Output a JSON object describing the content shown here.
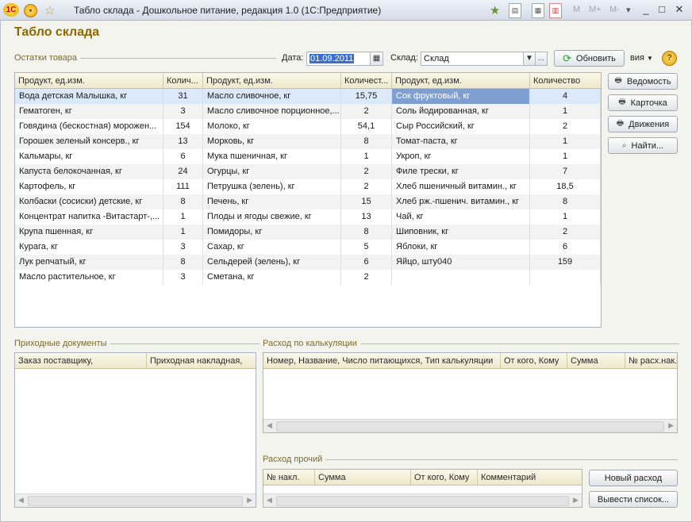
{
  "window": {
    "title": "Табло склада - Дошкольное питание, редакция 1.0  (1С:Предприятие)",
    "logo": "1С",
    "mem_buttons": [
      "M",
      "M+",
      "M-"
    ]
  },
  "form": {
    "title": "Табло склада",
    "stock_group": "Остатки товара",
    "date_label": "Дата:",
    "date_value": "01.09.2011",
    "warehouse_label": "Склад:",
    "warehouse_value": "Склад",
    "ellipsis": "...",
    "refresh_label": "Обновить",
    "actions_label": "вия",
    "help": "?"
  },
  "main_table": {
    "headers": [
      "Продукт, ед.изм.",
      "Колич...",
      "Продукт, ед.изм.",
      "Количест...",
      "Продукт, ед.изм.",
      "Количество"
    ],
    "rows": [
      [
        "Вода детская Малышка, кг",
        "31",
        "Масло сливочное, кг",
        "15,75",
        "Сок фруктовый, кг",
        "4"
      ],
      [
        "Гематоген, кг",
        "3",
        "Масло сливочное порционное,...",
        "2",
        "Соль йодированная, кг",
        "1"
      ],
      [
        "Говядина (бескостная) морожен...",
        "154",
        "Молоко, кг",
        "54,1",
        "Сыр Российский, кг",
        "2"
      ],
      [
        "Горошек зеленый консерв., кг",
        "13",
        "Морковь, кг",
        "8",
        "Томат-паста, кг",
        "1"
      ],
      [
        "Кальмары, кг",
        "6",
        "Мука пшеничная, кг",
        "1",
        "Укроп, кг",
        "1"
      ],
      [
        "Капуста белокочанная, кг",
        "24",
        "Огурцы, кг",
        "2",
        "Филе трески, кг",
        "7"
      ],
      [
        "Картофель, кг",
        "111",
        "Петрушка (зелень), кг",
        "2",
        "Хлеб пшеничный витамин., кг",
        "18,5"
      ],
      [
        "Колбаски (сосиски) детские, кг",
        "8",
        "Печень, кг",
        "15",
        "Хлеб рж.-пшенич. витамин., кг",
        "8"
      ],
      [
        "Концентрат напитка -Витастарт-,...",
        "1",
        "Плоды и ягоды свежие, кг",
        "13",
        "Чай, кг",
        "1"
      ],
      [
        "Крупа пшенная, кг",
        "1",
        "Помидоры, кг",
        "8",
        "Шиповник, кг",
        "2"
      ],
      [
        "Курага, кг",
        "3",
        "Сахар, кг",
        "5",
        "Яблоки, кг",
        "6"
      ],
      [
        "Лук репчатый, кг",
        "8",
        "Сельдерей (зелень), кг",
        "6",
        "Яйцо, шту040",
        "159"
      ],
      [
        "Масло растительное, кг",
        "3",
        "Сметана, кг",
        "2",
        "",
        ""
      ]
    ]
  },
  "side_buttons": {
    "statement": "Ведомость",
    "card": "Карточка",
    "movements": "Движения",
    "find": "Найти..."
  },
  "incoming": {
    "title": "Приходные документы",
    "headers": [
      "Заказ поставщику,",
      "Приходная накладная,"
    ]
  },
  "calc": {
    "title": "Расход по калькуляции",
    "headers": [
      "Номер, Название, Число питающихся, Тип калькуляции",
      "От кого, Кому",
      "Сумма",
      "№ расх.нак."
    ]
  },
  "other": {
    "title": "Расход прочий",
    "headers": [
      "№ накл.",
      "Сумма",
      "От кого, Кому",
      "Комментарий"
    ],
    "new_expense": "Новый расход",
    "print_list": "Вывести список..."
  }
}
